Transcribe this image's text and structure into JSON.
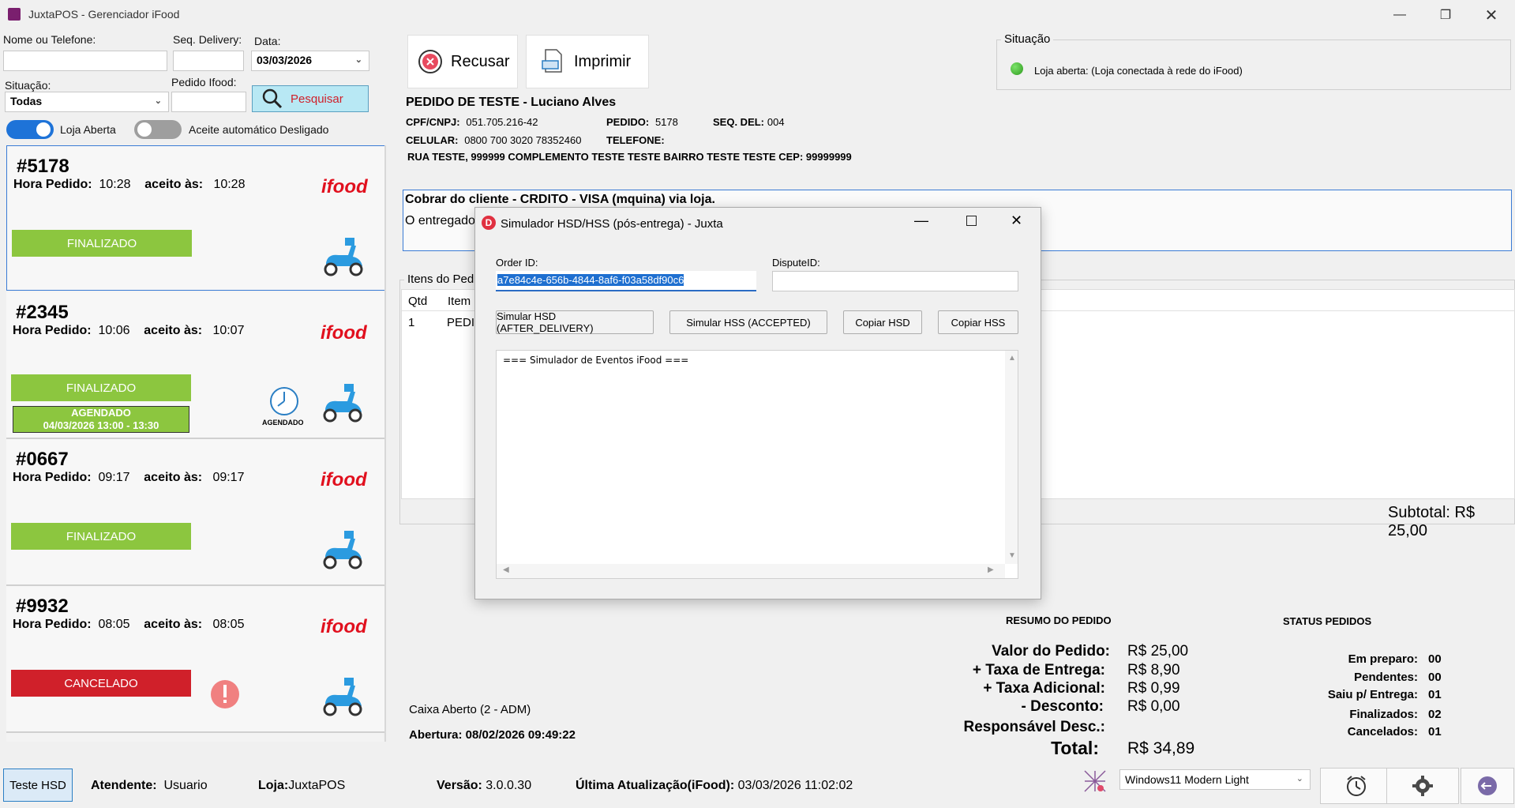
{
  "window": {
    "title": "JuxtaPOS - Gerenciador iFood"
  },
  "filters": {
    "name_label": "Nome ou Telefone:",
    "name_value": "",
    "seq_label": "Seq. Delivery:",
    "seq_value": "",
    "date_label": "Data:",
    "date_value": "03/03/2026",
    "situacao_label": "Situação:",
    "situacao_value": "Todas",
    "pedido_label": "Pedido Ifood:",
    "pedido_value": "",
    "search_button": "Pesquisar",
    "loja_toggle_label": "Loja Aberta",
    "aceite_toggle_label": "Aceite automático Desligado"
  },
  "orders": [
    {
      "id": "#5178",
      "hora_label": "Hora Pedido:",
      "hora": "10:28",
      "aceito_label": "aceito às:",
      "aceito": "10:28",
      "status": "FINALIZADO",
      "status_color": "#8cc63f",
      "ifood": "ifood"
    },
    {
      "id": "#2345",
      "hora_label": "Hora Pedido:",
      "hora": "10:06",
      "aceito_label": "aceito às:",
      "aceito": "10:07",
      "status": "FINALIZADO",
      "status_color": "#8cc63f",
      "ifood": "ifood",
      "agendado_title": "AGENDADO",
      "agendado_time": "04/03/2026 13:00 - 13:30",
      "agendado_icon_label": "AGENDADO"
    },
    {
      "id": "#0667",
      "hora_label": "Hora Pedido:",
      "hora": "09:17",
      "aceito_label": "aceito às:",
      "aceito": "09:17",
      "status": "FINALIZADO",
      "status_color": "#8cc63f",
      "ifood": "ifood"
    },
    {
      "id": "#9932",
      "hora_label": "Hora Pedido:",
      "hora": "08:05",
      "aceito_label": "aceito às:",
      "aceito": "08:05",
      "status": "CANCELADO",
      "status_color": "#d0202a",
      "ifood": "ifood"
    }
  ],
  "actions": {
    "recusar": "Recusar",
    "imprimir": "Imprimir"
  },
  "situacao": {
    "title": "Situação",
    "text": "Loja aberta: (Loja conectada à rede do iFood)"
  },
  "order_detail": {
    "title": "PEDIDO DE TESTE - Luciano Alves",
    "cpf_label": "CPF/CNPJ:",
    "cpf": "051.705.216-42",
    "pedido_label": "PEDIDO:",
    "pedido": "5178",
    "seqdel_label": "SEQ. DEL:",
    "seqdel": "004",
    "celular_label": "CELULAR:",
    "celular": "0800 700 3020 78352460",
    "telefone_label": "TELEFONE:",
    "address": "RUA TESTE, 999999 COMPLEMENTO TESTE TESTE  BAIRRO TESTE TESTE CEP: 99999999",
    "payment": "Cobrar do cliente - CRDITO - VISA (mquina) via loja.",
    "delivery_note": "O entregado",
    "items_legend": "Itens do Pedi",
    "items_header": {
      "qtd": "Qtd",
      "item": "Item"
    },
    "items": [
      {
        "qtd": "1",
        "item": "PEDID"
      }
    ],
    "subtotal": "Subtotal: R$ 25,00"
  },
  "dialog": {
    "title": "Simulador HSD/HSS (pós-entrega) - Juxta",
    "order_id_label": "Order ID:",
    "order_id": "a7e84c4e-656b-4844-8af6-f03a58df90c6",
    "dispute_label": "DisputeID:",
    "dispute_id": "",
    "btn_hsd": "Simular HSD (AFTER_DELIVERY)",
    "btn_hss": "Simular HSS (ACCEPTED)",
    "btn_copy_hsd": "Copiar HSD",
    "btn_copy_hss": "Copiar HSS",
    "log": "=== Simulador de Eventos iFood ==="
  },
  "caixa": {
    "status": "Caixa Aberto (2 - ADM)",
    "abertura": "Abertura: 08/02/2026 09:49:22"
  },
  "resumo": {
    "title": "RESUMO DO PEDIDO",
    "rows": [
      {
        "label": "Valor do Pedido:",
        "value": "R$ 25,00"
      },
      {
        "label": "+ Taxa de Entrega:",
        "value": "R$ 8,90"
      },
      {
        "label": "+ Taxa Adicional:",
        "value": "R$ 0,99"
      },
      {
        "label": "- Desconto:",
        "value": "R$ 0,00"
      },
      {
        "label": "Responsável Desc.:",
        "value": ""
      }
    ],
    "total_label": "Total:",
    "total_value": "R$ 34,89"
  },
  "status_pedidos": {
    "title": "STATUS PEDIDOS",
    "rows": [
      {
        "label": "Em preparo:",
        "value": "00"
      },
      {
        "label": "Pendentes:",
        "value": "00"
      },
      {
        "label": "Saiu p/ Entrega:",
        "value": "01"
      },
      {
        "label": "Finalizados:",
        "value": "02"
      },
      {
        "label": "Cancelados:",
        "value": "01"
      }
    ]
  },
  "footer": {
    "teste_hsd": "Teste HSD",
    "atendente_label": "Atendente:",
    "atendente": "Usuario",
    "loja_label": "Loja:",
    "loja": "JuxtaPOS",
    "versao_label": "Versão:",
    "versao": "3.0.0.30",
    "atualizacao_label": "Última Atualização(iFood):",
    "atualizacao": "03/03/2026 11:02:02",
    "theme": "Windows11 Modern Light"
  },
  "colors": {
    "accent": "#1e73d8",
    "finalizado": "#8cc63f",
    "cancelado": "#d0202a",
    "search_bg": "#b8e8f4"
  }
}
